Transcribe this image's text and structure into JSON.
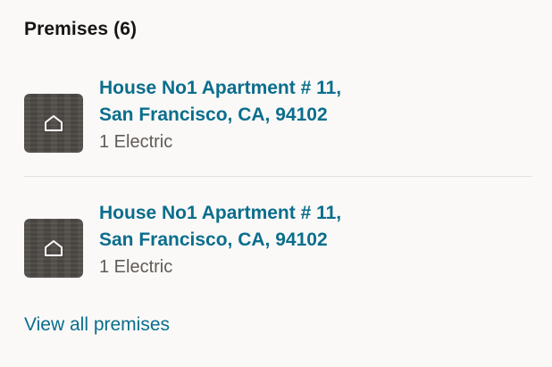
{
  "premises": {
    "title": "Premises (6)",
    "items": [
      {
        "address_line1": "House No1 Apartment # 11,",
        "address_line2": "San Francisco, CA, 94102",
        "services": "1 Electric",
        "icon": "home-icon"
      },
      {
        "address_line1": "House No1 Apartment # 11,",
        "address_line2": "San Francisco, CA, 94102",
        "services": "1 Electric",
        "icon": "home-icon"
      }
    ],
    "view_all_label": "View all premises"
  },
  "colors": {
    "background": "#fbf9f8",
    "title": "#161513",
    "link": "#0a6e8c",
    "secondary_text": "#5f5b56",
    "thumbnail": "#4f4b47",
    "divider": "#e2dfdc"
  }
}
